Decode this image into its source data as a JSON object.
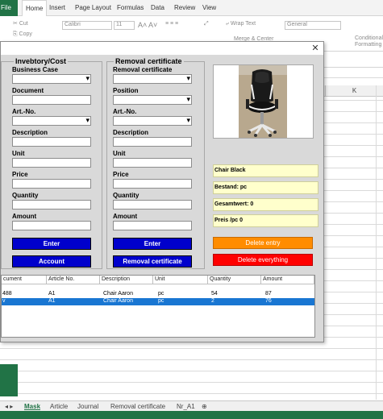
{
  "excel": {
    "tabs": [
      "File",
      "Home",
      "Insert",
      "Page Layout",
      "Formulas",
      "Data",
      "Review",
      "View"
    ],
    "active_tab": "Home",
    "clipboard": {
      "cut": "Cut",
      "copy": "Copy"
    },
    "font_name": "Calibri",
    "font_size": "11",
    "wrap_text": "Wrap Text",
    "merge_center": "Merge & Center",
    "number_format": "General",
    "conditional_formatting": "Conditional Formatting",
    "column_k": "K",
    "sheets": [
      "Mask",
      "Article",
      "Journal",
      "Removal certificate",
      "Nr_A1"
    ],
    "active_sheet": "Mask",
    "add_sheet_icon": "plus-circle-icon"
  },
  "dialog": {
    "close_glyph": "✕",
    "left_frame": {
      "title": "Invebtory/Cost",
      "labels": {
        "business_case": "Business Case",
        "document": "Document",
        "art_no": "Art.-No.",
        "description": "Description",
        "unit": "Unit",
        "price": "Price",
        "quantity": "Quantity",
        "amount": "Amount"
      },
      "enter_button": "Enter",
      "account_button": "Account"
    },
    "right_frame": {
      "title": "Removal certificate",
      "labels": {
        "removal_certificate": "Removal certificate",
        "position": "Position",
        "art_no": "Art.-No.",
        "description": "Description",
        "unit": "Unit",
        "price": "Price",
        "quantity": "Quantity",
        "amount": "Amount"
      },
      "enter_button": "Enter",
      "removal_button": "Removal certificate"
    },
    "info": {
      "name": "Chair Black",
      "stock": "Bestand:  pc",
      "total_value": "Gesamtwert: 0",
      "price_per_pc": "Preis /pc 0"
    },
    "delete_entry_button": "Delete entry",
    "delete_everything_button": "Delete everything",
    "colors": {
      "blue_button": "#0000cc",
      "orange_button": "#ff8c00",
      "red_button": "#ff0000",
      "info_bg": "#ffffcc",
      "selection": "#1976d2"
    },
    "list": {
      "columns": [
        "cument",
        "Article No.",
        "Description",
        "Unit",
        "Quantity",
        "Amount"
      ],
      "rows": [
        [
          "488",
          "A1",
          "Chair Aaron",
          "pc",
          "54",
          "87"
        ],
        [
          "v",
          "A1",
          "Chair Aaron",
          "pc",
          "2",
          "76"
        ]
      ],
      "selected_row": 1
    }
  }
}
